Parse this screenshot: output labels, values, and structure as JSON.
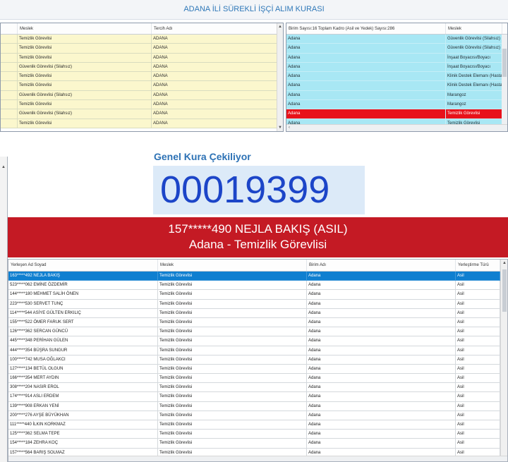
{
  "app_title": "ADANA İLİ SÜREKLİ İŞÇİ ALIM KURASI",
  "left_grid": {
    "headers": [
      "Meslek",
      "Tercih Adı"
    ],
    "rows": [
      [
        "Temizlik Görevlisi",
        "ADANA"
      ],
      [
        "Temizlik Görevlisi",
        "ADANA"
      ],
      [
        "Temizlik Görevlisi",
        "ADANA"
      ],
      [
        "Güvenlik Görevlisi (Silahsız)",
        "ADANA"
      ],
      [
        "Temizlik Görevlisi",
        "ADANA"
      ],
      [
        "Temizlik Görevlisi",
        "ADANA"
      ],
      [
        "Güvenlik Görevlisi (Silahsız)",
        "ADANA"
      ],
      [
        "Temizlik Görevlisi",
        "ADANA"
      ],
      [
        "Güvenlik Görevlisi (Silahsız)",
        "ADANA"
      ],
      [
        "Temizlik Görevlisi",
        "ADANA"
      ]
    ]
  },
  "right_grid": {
    "headers": [
      "Birim Sayısı:16 Toplam Kadro (Asil ve Yedek) Sayısı:286",
      "Meslek"
    ],
    "rows": [
      [
        "Adana",
        "Güvenlik Görevlisi (Silahsız)"
      ],
      [
        "Adana",
        "Güvenlik Görevlisi (Silahsız)"
      ],
      [
        "Adana",
        "İnşaat Boyacısı/Boyacı"
      ],
      [
        "Adana",
        "İnşaat Boyacısı/Boyacı"
      ],
      [
        "Adana",
        "Klinik Destek Elemanı (Hastan"
      ],
      [
        "Adana",
        "Klinik Destek Elemanı (Hastan"
      ],
      [
        "Adana",
        "Marangoz"
      ],
      [
        "Adana",
        "Marangoz"
      ],
      [
        "Adana",
        "Temizlik Görevlisi"
      ],
      [
        "Adana",
        "Temizlik Görevlisi"
      ]
    ],
    "selected_index": 8
  },
  "draw": {
    "label": "Genel Kura Çekiliyor",
    "number": "00019399"
  },
  "winner": {
    "line1": "157*****490 NEJLA BAKIŞ (ASIL)",
    "line2": "Adana - Temizlik Görevlisi"
  },
  "results_grid": {
    "headers": [
      "Yerleşen Ad Soyad",
      "Meslek",
      "Birim Adı",
      "Yerleştirme Türü"
    ],
    "rows": [
      [
        "163*****492 NEJLA BAKIŞ",
        "Temizlik Görevlisi",
        "Adana",
        "Asil"
      ],
      [
        "523*****062 EMİNE ÖZDEMİR",
        "Temizlik Görevlisi",
        "Adana",
        "Asil"
      ],
      [
        "144*****180 MEHMET SALİH ÖNEN",
        "Temizlik Görevlisi",
        "Adana",
        "Asil"
      ],
      [
        "223*****530 SERVET TUNÇ",
        "Temizlik Görevlisi",
        "Adana",
        "Asil"
      ],
      [
        "114*****544 ASİYE GÜLTEN ERKILIÇ",
        "Temizlik Görevlisi",
        "Adana",
        "Asil"
      ],
      [
        "155*****522 ÖMER FARUK SERT",
        "Temizlik Görevlisi",
        "Adana",
        "Asil"
      ],
      [
        "126*****362 SERCAN GÜNCÜ",
        "Temizlik Görevlisi",
        "Adana",
        "Asil"
      ],
      [
        "445*****348 PERİHAN GÜLEN",
        "Temizlik Görevlisi",
        "Adana",
        "Asil"
      ],
      [
        "444*****354 BÜŞRA SUNGUR",
        "Temizlik Görevlisi",
        "Adana",
        "Asil"
      ],
      [
        "100*****742 MUSA OĞLAKCI",
        "Temizlik Görevlisi",
        "Adana",
        "Asil"
      ],
      [
        "127*****134 BETÜL OLGUN",
        "Temizlik Görevlisi",
        "Adana",
        "Asil"
      ],
      [
        "166*****354 MERT AYDIN",
        "Temizlik Görevlisi",
        "Adana",
        "Asil"
      ],
      [
        "308*****204 NASIR EROL",
        "Temizlik Görevlisi",
        "Adana",
        "Asil"
      ],
      [
        "174*****914 ASLI ERDEM",
        "Temizlik Görevlisi",
        "Adana",
        "Asil"
      ],
      [
        "139*****908 ERKAN YENİ",
        "Temizlik Görevlisi",
        "Adana",
        "Asil"
      ],
      [
        "200*****276 AYŞE BÜYÜKHAN",
        "Temizlik Görevlisi",
        "Adana",
        "Asil"
      ],
      [
        "111*****440 İLKIN KORKMAZ",
        "Temizlik Görevlisi",
        "Adana",
        "Asil"
      ],
      [
        "125*****362 SELMA TEPE",
        "Temizlik Görevlisi",
        "Adana",
        "Asil"
      ],
      [
        "154*****184 ZEHRA KOÇ",
        "Temizlik Görevlisi",
        "Adana",
        "Asil"
      ],
      [
        "157*****564 BARIŞ SOLMAZ",
        "Temizlik Görevlisi",
        "Adana",
        "Asil"
      ]
    ],
    "selected_index": 0
  },
  "colors": {
    "left_row_bg": "#fbf7cd",
    "right_row_bg": "#a8e7f4",
    "selected_red": "#e8111a",
    "banner_red": "#c41a24",
    "selected_blue": "#0f7fd0",
    "counter_text": "#1c45c8",
    "title_text": "#2f78b8"
  },
  "icons": [
    "scroll-up-arrow-icon",
    "scroll-down-arrow-icon",
    "scroll-left-arrow-icon",
    "scroll-right-arrow-icon"
  ]
}
